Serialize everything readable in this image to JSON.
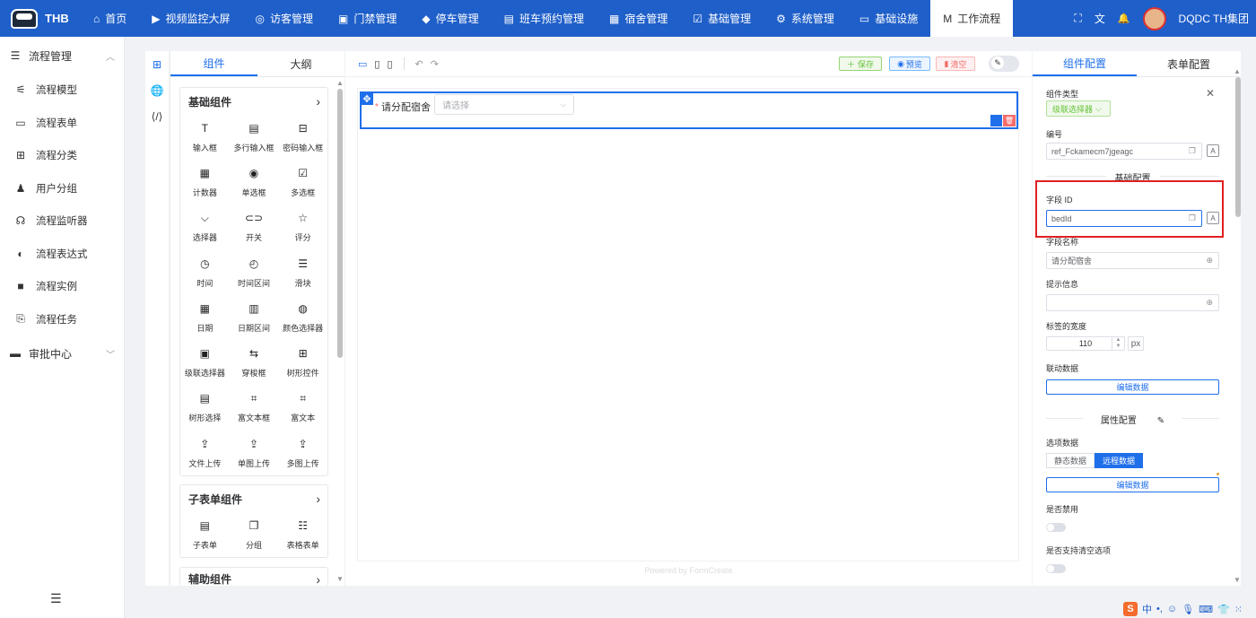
{
  "brand": {
    "name": "THB"
  },
  "nav": {
    "items": [
      {
        "label": "首页",
        "icon": "home-icon",
        "glyph": "⌂"
      },
      {
        "label": "视频监控大屏",
        "icon": "video-icon",
        "glyph": "▶"
      },
      {
        "label": "访客管理",
        "icon": "location-icon",
        "glyph": "◎"
      },
      {
        "label": "门禁管理",
        "icon": "gate-icon",
        "glyph": "▣"
      },
      {
        "label": "停车管理",
        "icon": "car-icon",
        "glyph": "◆"
      },
      {
        "label": "班车预约管理",
        "icon": "bus-icon",
        "glyph": "▤"
      },
      {
        "label": "宿舍管理",
        "icon": "bed-icon",
        "glyph": "▦"
      },
      {
        "label": "基础管理",
        "icon": "calendar-check-icon",
        "glyph": "☑"
      },
      {
        "label": "系统管理",
        "icon": "gear-icon",
        "glyph": "⚙"
      },
      {
        "label": "基础设施",
        "icon": "monitor-icon",
        "glyph": "▭"
      },
      {
        "label": "工作流程",
        "icon": "workflow-icon",
        "glyph": "M"
      }
    ],
    "user": "DQDC TH集团",
    "right_icons": {
      "fullscreen": "⛶",
      "translate": "文",
      "bell": "🔔"
    }
  },
  "sidebar": {
    "group1": {
      "label": "流程管理",
      "icon": "list-icon",
      "glyph": "☰"
    },
    "items": [
      {
        "label": "流程模型",
        "icon": "model-icon",
        "glyph": "⚟"
      },
      {
        "label": "流程表单",
        "icon": "form-icon",
        "glyph": "▭"
      },
      {
        "label": "流程分类",
        "icon": "category-icon",
        "glyph": "⊞"
      },
      {
        "label": "用户分组",
        "icon": "user-group-icon",
        "glyph": "♟"
      },
      {
        "label": "流程监听器",
        "icon": "listener-icon",
        "glyph": "☊"
      },
      {
        "label": "流程表达式",
        "icon": "expression-icon",
        "glyph": "◐"
      },
      {
        "label": "流程实例",
        "icon": "instance-icon",
        "glyph": "■"
      },
      {
        "label": "流程任务",
        "icon": "task-icon",
        "glyph": "⎘"
      }
    ],
    "group2": {
      "label": "审批中心",
      "icon": "approval-icon",
      "glyph": "▬"
    }
  },
  "palette": {
    "tabs": [
      "组件",
      "大纲"
    ],
    "sections": [
      {
        "title": "基础组件",
        "items": [
          {
            "label": "输入框",
            "icon": "input-icon",
            "glyph": "T"
          },
          {
            "label": "多行输入框",
            "icon": "textarea-icon",
            "glyph": "▤"
          },
          {
            "label": "密码输入框",
            "icon": "password-icon",
            "glyph": "⊟"
          },
          {
            "label": "计数器",
            "icon": "counter-icon",
            "glyph": "▦"
          },
          {
            "label": "单选框",
            "icon": "radio-icon",
            "glyph": "◉"
          },
          {
            "label": "多选框",
            "icon": "checkbox-icon",
            "glyph": "☑"
          },
          {
            "label": "选择器",
            "icon": "select-icon",
            "glyph": "⌵"
          },
          {
            "label": "开关",
            "icon": "switch-icon",
            "glyph": "⊂⊃"
          },
          {
            "label": "评分",
            "icon": "star-icon",
            "glyph": "☆"
          },
          {
            "label": "时间",
            "icon": "clock-icon",
            "glyph": "◷"
          },
          {
            "label": "时间区间",
            "icon": "time-range-icon",
            "glyph": "◴"
          },
          {
            "label": "滑块",
            "icon": "slider-icon",
            "glyph": "☰"
          },
          {
            "label": "日期",
            "icon": "date-icon",
            "glyph": "▦"
          },
          {
            "label": "日期区间",
            "icon": "date-range-icon",
            "glyph": "▥"
          },
          {
            "label": "颜色选择器",
            "icon": "palette-icon",
            "glyph": "◍"
          },
          {
            "label": "级联选择器",
            "icon": "cascader-icon",
            "glyph": "▣"
          },
          {
            "label": "穿梭框",
            "icon": "transfer-icon",
            "glyph": "⇆"
          },
          {
            "label": "树形控件",
            "icon": "tree-icon",
            "glyph": "⊞"
          },
          {
            "label": "树形选择",
            "icon": "tree-select-icon",
            "glyph": "▤"
          },
          {
            "label": "富文本框",
            "icon": "richtext-box-icon",
            "glyph": "⌗"
          },
          {
            "label": "富文本",
            "icon": "richtext-icon",
            "glyph": "⌗"
          },
          {
            "label": "文件上传",
            "icon": "upload-icon",
            "glyph": "⇪"
          },
          {
            "label": "单图上传",
            "icon": "image-upload-icon",
            "glyph": "⇪"
          },
          {
            "label": "多图上传",
            "icon": "multi-image-upload-icon",
            "glyph": "⇪"
          }
        ]
      },
      {
        "title": "子表单组件",
        "items": [
          {
            "label": "子表单",
            "icon": "subform-icon",
            "glyph": "▤"
          },
          {
            "label": "分组",
            "icon": "group-icon",
            "glyph": "❐"
          },
          {
            "label": "表格表单",
            "icon": "table-form-icon",
            "glyph": "☷"
          }
        ]
      },
      {
        "title": "辅助组件",
        "items": []
      }
    ]
  },
  "toolbar": {
    "save": "保存",
    "preview": "预览",
    "clear": "清空"
  },
  "canvas": {
    "field_label": "请分配宿舍",
    "placeholder": "请选择",
    "powered_by": "Powered by FormCreate"
  },
  "config": {
    "tabs": [
      "组件配置",
      "表单配置"
    ],
    "component_type_label": "组件类型",
    "component_type_value": "级联选择器",
    "ref_label": "编号",
    "ref_value": "ref_Fckamecm7jgeagc",
    "basic_section": "基础配置",
    "field_id_label": "字段 ID",
    "field_id_value": "bedId",
    "field_name_label": "字段名称",
    "field_name_value": "请分配宿舍",
    "hint_label": "提示信息",
    "hint_value": "",
    "label_width_label": "标签的宽度",
    "label_width_value": "110",
    "label_width_unit": "px",
    "link_label": "联动数据",
    "edit_data": "编辑数据",
    "attr_section": "属性配置",
    "options_label": "选项数据",
    "static_data": "静态数据",
    "remote_data": "远程数据",
    "disabled_label": "是否禁用",
    "clearable_label": "是否支持清空选项"
  },
  "ime": {
    "logo": "S",
    "lang": "中"
  }
}
